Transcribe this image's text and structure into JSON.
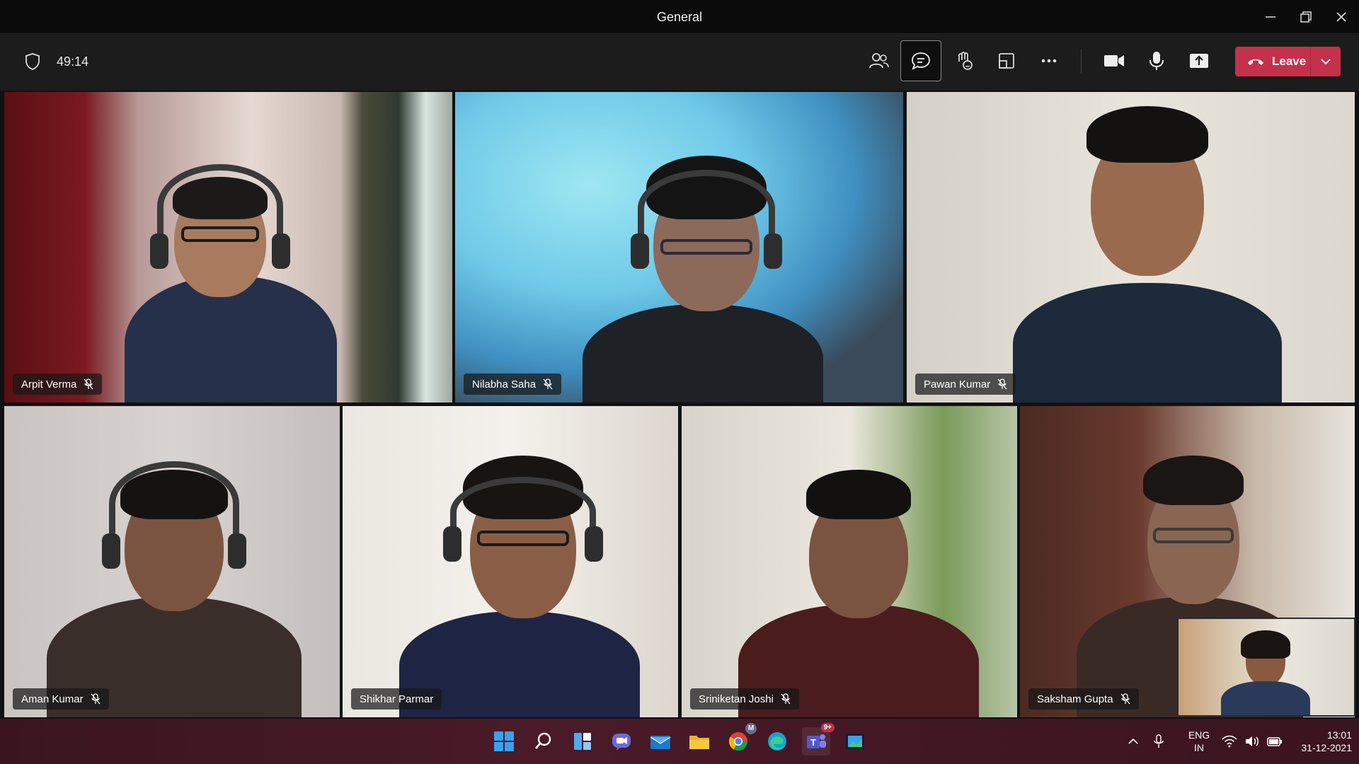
{
  "window": {
    "title": "General"
  },
  "toolbar": {
    "timer": "49:14",
    "leave_label": "Leave",
    "icons": [
      "participants-icon",
      "chat-icon",
      "reactions-icon",
      "rooms-icon",
      "more-icon",
      "camera-icon",
      "mic-icon",
      "share-icon"
    ]
  },
  "participants": [
    {
      "name": "Arpit Verma",
      "muted": true
    },
    {
      "name": "Nilabha Saha",
      "muted": true
    },
    {
      "name": "Pawan Kumar",
      "muted": true
    },
    {
      "name": "Aman Kumar",
      "muted": true
    },
    {
      "name": "Shikhar Parmar",
      "muted": false
    },
    {
      "name": "Sriniketan Joshi",
      "muted": true
    },
    {
      "name": "Saksham Gupta",
      "muted": true
    }
  ],
  "taskbar": {
    "apps": [
      "windows-start-icon",
      "search-icon",
      "widgets-icon",
      "teams-chat-icon",
      "mail-icon",
      "file-explorer-icon",
      "chrome-icon",
      "edge-icon",
      "teams-icon",
      "snipping-tool-icon"
    ],
    "teams_badge": "9+",
    "chrome_badge": "M"
  },
  "tray": {
    "lang_top": "ENG",
    "lang_bottom": "IN",
    "time": "13:01",
    "date": "31-12-2021"
  },
  "colors": {
    "accent_leave": "#c4314b",
    "taskbar": "#4a1a28"
  }
}
